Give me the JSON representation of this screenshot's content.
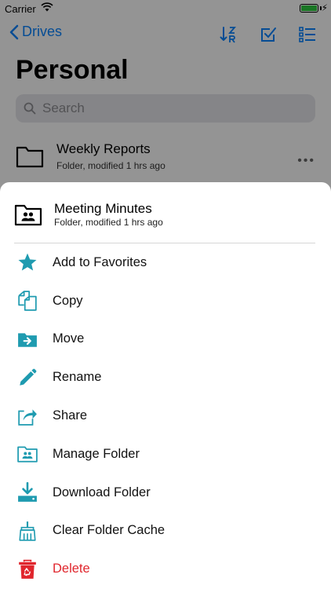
{
  "status_bar": {
    "carrier": "Carrier",
    "bolt": "⚡"
  },
  "nav": {
    "back_label": "Drives"
  },
  "page": {
    "title": "Personal"
  },
  "search": {
    "placeholder": "Search"
  },
  "background_row": {
    "title": "Weekly Reports",
    "subtitle": "Folder, modified 1 hrs ago",
    "more": "•••"
  },
  "sheet": {
    "title": "Meeting Minutes",
    "subtitle": "Folder, modified 1 hrs ago",
    "actions": [
      {
        "label": "Add to Favorites",
        "icon": "star-icon"
      },
      {
        "label": "Copy",
        "icon": "copy-icon"
      },
      {
        "label": "Move",
        "icon": "move-folder-icon"
      },
      {
        "label": "Rename",
        "icon": "pencil-icon"
      },
      {
        "label": "Share",
        "icon": "share-icon"
      },
      {
        "label": "Manage Folder",
        "icon": "shared-folder-icon"
      },
      {
        "label": "Download Folder",
        "icon": "download-icon"
      },
      {
        "label": "Clear Folder Cache",
        "icon": "broom-icon"
      },
      {
        "label": "Delete",
        "icon": "trash-icon"
      }
    ]
  },
  "colors": {
    "accent": "#0a84ff",
    "teal": "#1f9bb0",
    "danger": "#e0262d"
  }
}
